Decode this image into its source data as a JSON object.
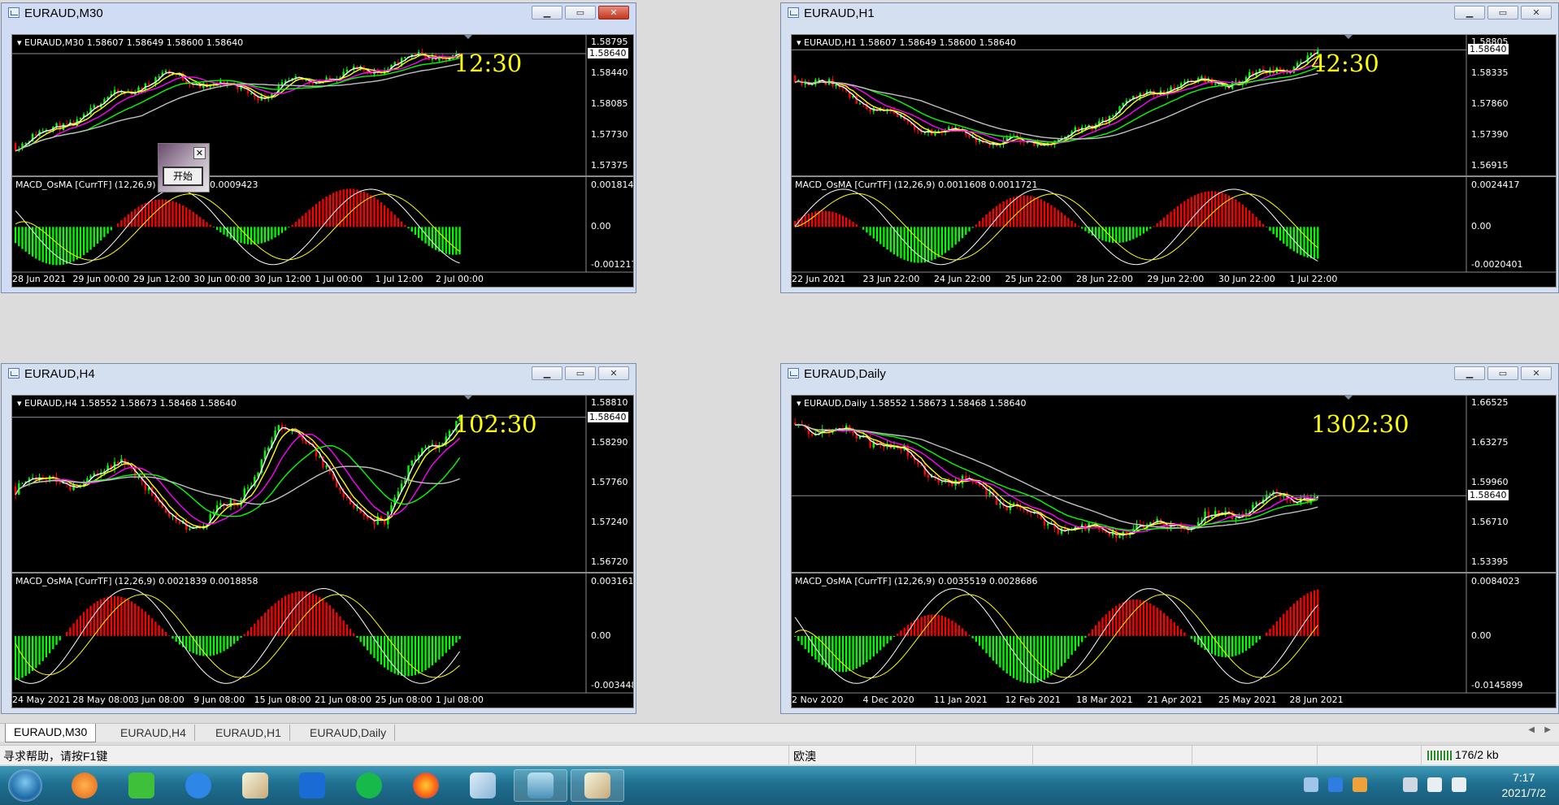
{
  "windows": [
    {
      "id": "m30",
      "title": "EURAUD,M30",
      "ohlc": "EURAUD,M30  1.58607 1.58649 1.58600 1.58640",
      "countdown": "12:30",
      "price_labels": [
        "1.58795",
        "1.58440",
        "1.58085",
        "1.57730",
        "1.57375"
      ],
      "current_price": "1.58640",
      "macd_label": "MACD_OsMA [CurrTF] (12,26,9) 0.0006891 0.0009423",
      "macd_labels": [
        "0.0018143",
        "0.00",
        "-0.001217"
      ],
      "time_labels": [
        "28 Jun 2021",
        "29 Jun 00:00",
        "29 Jun 12:00",
        "30 Jun 00:00",
        "30 Jun 12:00",
        "1 Jul 00:00",
        "1 Jul 12:00",
        "2 Jul 00:00"
      ],
      "seed": 11,
      "trend": [
        0.2,
        0.35,
        0.6,
        0.78,
        0.7,
        0.62,
        0.75,
        0.8,
        0.92,
        0.96
      ]
    },
    {
      "id": "h1",
      "title": "EURAUD,H1",
      "ohlc": "EURAUD,H1  1.58607 1.58649 1.58600 1.58640",
      "countdown": "42:30",
      "price_labels": [
        "1.58805",
        "1.58335",
        "1.57860",
        "1.57390",
        "1.56915"
      ],
      "current_price": "1.58640",
      "macd_label": "MACD_OsMA [CurrTF] (12,26,9) 0.0011608 0.0011721",
      "macd_labels": [
        "0.0024417",
        "0.00",
        "-0.0020401"
      ],
      "time_labels": [
        "22 Jun 2021",
        "23 Jun 22:00",
        "24 Jun 22:00",
        "25 Jun 22:00",
        "28 Jun 22:00",
        "29 Jun 22:00",
        "30 Jun 22:00",
        "1 Jul 22:00"
      ],
      "seed": 23,
      "trend": [
        0.78,
        0.65,
        0.42,
        0.3,
        0.22,
        0.2,
        0.28,
        0.55,
        0.7,
        0.72,
        0.8,
        0.95
      ]
    },
    {
      "id": "h4",
      "title": "EURAUD,H4",
      "ohlc": "EURAUD,H4  1.58552 1.58673 1.58468 1.58640",
      "countdown": "102:30",
      "price_labels": [
        "1.58810",
        "1.58290",
        "1.57760",
        "1.57240",
        "1.56720"
      ],
      "current_price": "1.58640",
      "macd_label": "MACD_OsMA [CurrTF] (12,26,9) 0.0021839 0.0018858",
      "macd_labels": [
        "0.0031612",
        "0.00",
        "-0.0034485"
      ],
      "time_labels": [
        "24 May 2021",
        "28 May 08:00",
        "3 Jun 08:00",
        "9 Jun 08:00",
        "15 Jun 08:00",
        "21 Jun 08:00",
        "25 Jun 08:00",
        "1 Jul 08:00"
      ],
      "seed": 37,
      "trend": [
        0.5,
        0.55,
        0.52,
        0.7,
        0.3,
        0.25,
        0.4,
        0.85,
        0.8,
        0.35,
        0.3,
        0.75,
        0.9
      ]
    },
    {
      "id": "d1",
      "title": "EURAUD,Daily",
      "ohlc": "EURAUD,Daily  1.58552 1.58673 1.58468 1.58640",
      "countdown": "1302:30",
      "price_labels": [
        "1.66525",
        "1.63275",
        "1.59960",
        "1.56710",
        "1.53395"
      ],
      "current_price": "1.58640",
      "macd_label": "MACD_OsMA [CurrTF] (12,26,9) 0.0035519 0.0028686",
      "macd_labels": [
        "0.0084023",
        "0.00",
        "-0.0145899"
      ],
      "time_labels": [
        "2 Nov 2020",
        "4 Dec 2020",
        "11 Jan 2021",
        "12 Feb 2021",
        "18 Mar 2021",
        "21 Apr 2021",
        "25 May 2021",
        "28 Jun 2021"
      ],
      "seed": 53,
      "trend": [
        0.92,
        0.85,
        0.78,
        0.55,
        0.48,
        0.3,
        0.2,
        0.22,
        0.26,
        0.3,
        0.42,
        0.45
      ]
    }
  ],
  "popup": {
    "button_label": "开始",
    "close_label": "✕"
  },
  "window_buttons": {
    "minimize": "▁",
    "maximize": "▭",
    "close": "✕"
  },
  "tabs": [
    "EURAUD,M30",
    "EURAUD,H4",
    "EURAUD,H1",
    "EURAUD,Daily"
  ],
  "tab_nav": {
    "prev": "◀",
    "next": "▶"
  },
  "status": {
    "help": "寻求帮助，请按F1键",
    "profile": "欧澳",
    "traffic": "176/2 kb"
  },
  "taskbar": {
    "time": "7:17",
    "date": "2021/7/2"
  },
  "colors": {
    "bull": "#00ff00",
    "bear": "#ff0000",
    "ma1": "#ffffff",
    "ma2": "#ffff00",
    "ma3": "#ff00ff",
    "ma4": "#00ff00",
    "ma5": "#c0c0c0",
    "macd_signal": "#ffff00",
    "macd_main": "#ffffff",
    "countdown": "#ffff00"
  }
}
